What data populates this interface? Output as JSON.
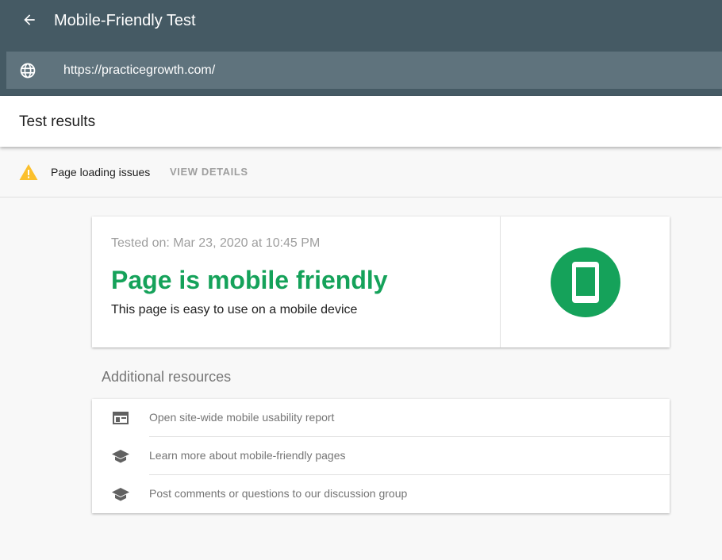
{
  "header": {
    "title": "Mobile-Friendly Test",
    "back_icon": "arrow-back-icon",
    "url": "https://practicegrowth.com/",
    "url_icon": "globe-icon"
  },
  "results": {
    "title": "Test results"
  },
  "issues": {
    "label": "Page loading issues",
    "action": "VIEW DETAILS",
    "icon": "warning-icon",
    "icon_color": "#fbc02d"
  },
  "result_card": {
    "tested_on": "Tested on: Mar 23, 2020 at 10:45 PM",
    "headline": "Page is mobile friendly",
    "description": "This page is easy to use on a mobile device",
    "status_color": "#15a25a",
    "badge_icon": "smartphone-icon"
  },
  "resources": {
    "title": "Additional resources",
    "items": [
      {
        "label": "Open site-wide mobile usability report",
        "icon": "web-report-icon"
      },
      {
        "label": "Learn more about mobile-friendly pages",
        "icon": "graduation-cap-icon"
      },
      {
        "label": "Post comments or questions to our discussion group",
        "icon": "graduation-cap-icon"
      }
    ]
  },
  "colors": {
    "header_bg": "#455a64",
    "url_bar_bg": "#5f737d",
    "page_bg": "#f8f8f8"
  }
}
